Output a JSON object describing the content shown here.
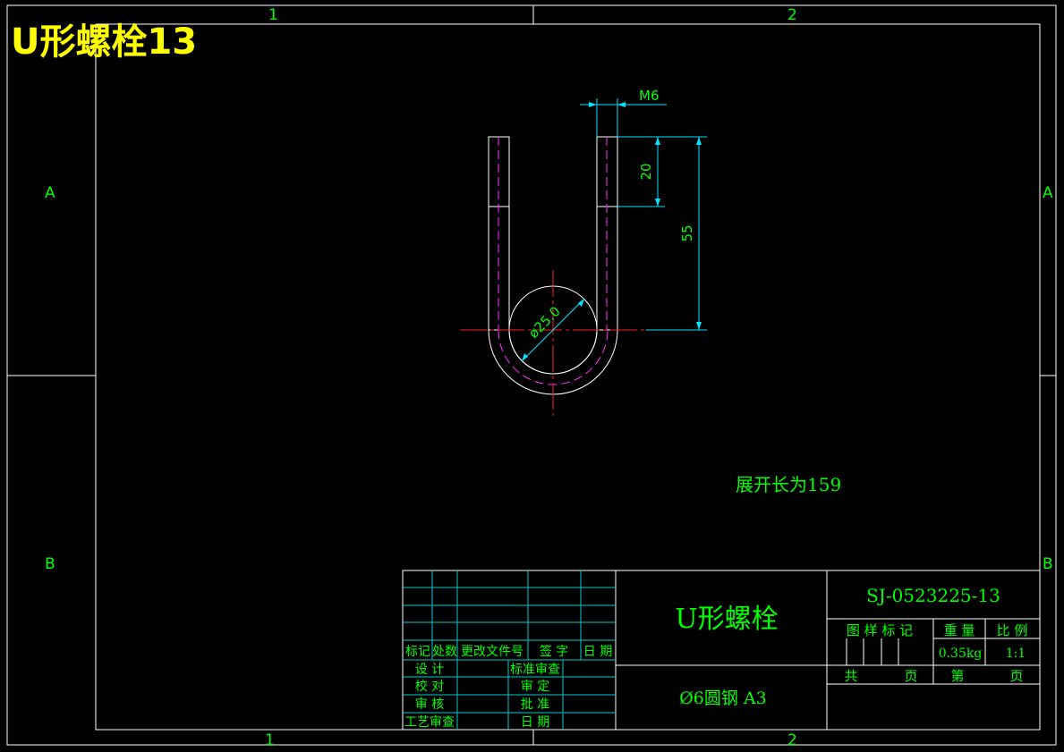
{
  "title_overlay": "U形螺栓13",
  "zone_marks": {
    "col1": "1",
    "col2": "2",
    "rowA": "A",
    "rowB": "B"
  },
  "dimensions": {
    "thread": "M6",
    "thread_len": "20",
    "leg_len": "55",
    "bend_dia": "ø25.0"
  },
  "note": "展开长为159",
  "title_block": {
    "part_name": "U形螺栓",
    "material": "Ø6圆钢 A3",
    "drawing_no": "SJ-0523225-13",
    "sample_mark": "图 样 标 记",
    "weight_label": "重  量",
    "scale_label": "比  例",
    "weight": "0.35kg",
    "scale": "1:1",
    "total_label": "共",
    "sheet_unit": "页",
    "sheet_label": "第",
    "sheet_unit2": "页",
    "rev_headers": [
      "标记",
      "处数",
      "更改文件号",
      "签  字",
      "日  期"
    ],
    "sig_left": [
      "设  计",
      "校  对",
      "审  核",
      "工艺审查"
    ],
    "sig_right": [
      "标准审查",
      "审  定",
      "批  准",
      "日  期"
    ]
  },
  "colors": {
    "frame": "#ffffff",
    "dim": "#00e5ff",
    "text": "#00ff00",
    "center": "#ff2020",
    "hidden": "#ff33ff",
    "title": "#ffff00",
    "grid": "#00cccc"
  }
}
